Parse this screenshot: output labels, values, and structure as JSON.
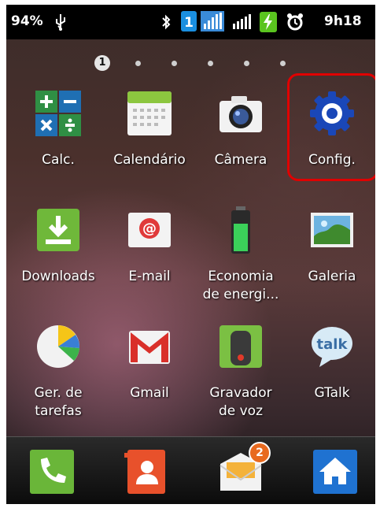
{
  "status_bar": {
    "battery_percent": "94%",
    "sim_badge": "1",
    "time": "9h18",
    "icons": [
      "usb-icon",
      "bluetooth-icon",
      "sim-icon",
      "signal-icon",
      "signal-icon",
      "battery-icon",
      "alarm-icon"
    ]
  },
  "pager": {
    "current_page": "1",
    "total_pages": 7
  },
  "apps": [
    {
      "label": "Calc.",
      "icon": "calculator-icon"
    },
    {
      "label": "Calendário",
      "icon": "calendar-icon"
    },
    {
      "label": "Câmera",
      "icon": "camera-icon"
    },
    {
      "label": "Config.",
      "icon": "settings-gear-icon"
    },
    {
      "label": "Downloads",
      "icon": "download-icon"
    },
    {
      "label": "E-mail",
      "icon": "email-icon"
    },
    {
      "label_line1": "Economia",
      "label_line2": "de energi...",
      "icon": "power-saving-icon"
    },
    {
      "label": "Galeria",
      "icon": "gallery-icon"
    },
    {
      "label_line1": "Ger. de",
      "label_line2": "tarefas",
      "icon": "task-manager-icon"
    },
    {
      "label": "Gmail",
      "icon": "gmail-icon"
    },
    {
      "label_line1": "Gravador",
      "label_line2": "de voz",
      "icon": "voice-recorder-icon"
    },
    {
      "label": "GTalk",
      "icon": "gtalk-icon",
      "icon_text": "talk"
    }
  ],
  "dock": {
    "items": [
      {
        "icon": "phone-icon"
      },
      {
        "icon": "contacts-icon"
      },
      {
        "icon": "messaging-icon",
        "badge": "2"
      },
      {
        "icon": "home-icon"
      }
    ]
  },
  "colors": {
    "highlight": "#e00000",
    "settings_blue": "#1a47b8",
    "status_bar": "#000000"
  }
}
